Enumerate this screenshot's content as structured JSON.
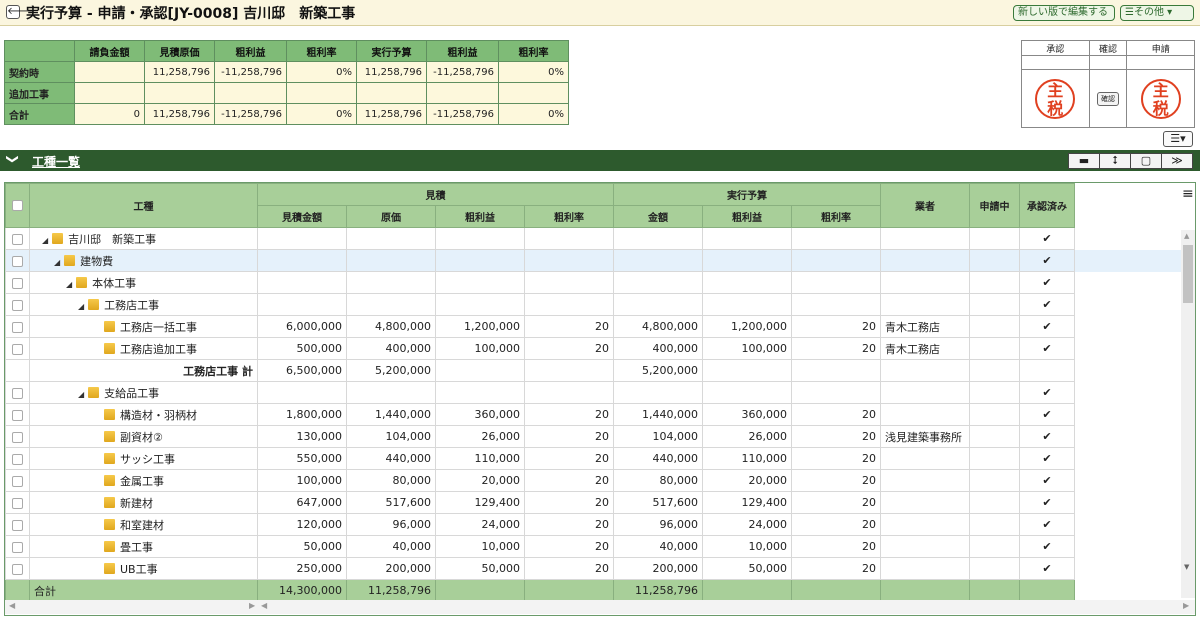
{
  "title": "実行予算 - 申請・承認[JY-0008] 吉川邸　新築工事",
  "toolbar": {
    "back_icon": "🡐",
    "new_version_label": "新しい版で編集する",
    "other_label": "☰その他 ▾"
  },
  "summary": {
    "headers": [
      "",
      "請負金額",
      "見積原価",
      "粗利益",
      "粗利率",
      "実行予算",
      "粗利益",
      "粗利率"
    ],
    "rows": [
      [
        "契約時",
        "",
        "11,258,796",
        "-11,258,796",
        "0%",
        "11,258,796",
        "-11,258,796",
        "0%"
      ],
      [
        "追加工事",
        "",
        "",
        "",
        "",
        "",
        "",
        ""
      ],
      [
        "合計",
        "0",
        "11,258,796",
        "-11,258,796",
        "0%",
        "11,258,796",
        "-11,258,796",
        "0%"
      ]
    ]
  },
  "approval": {
    "headers": [
      "承認",
      "確認",
      "申請"
    ],
    "stamp_text": "主\n税",
    "confirm_label": "確認",
    "menu_icon": "☰▾",
    "stamp_color": "#e04020"
  },
  "section": {
    "title": "工種一覧",
    "collapse_icon": "❯",
    "buttons": [
      "▬",
      "⭥",
      "▢",
      "≫"
    ]
  },
  "grid": {
    "group_headers": {
      "kind": "工種",
      "estimate": "見積",
      "budget": "実行予算",
      "vendor": "業者",
      "pending": "申請中",
      "approved": "承認済み"
    },
    "sub_headers": [
      "見積金額",
      "原価",
      "粗利益",
      "粗利率",
      "金額",
      "粗利益",
      "粗利率"
    ],
    "check_mark": "✔",
    "rows": [
      {
        "level": 0,
        "tri": true,
        "folder": true,
        "name": "吉川邸　新築工事",
        "vals": [
          "",
          "",
          "",
          "",
          "",
          "",
          ""
        ],
        "vendor": "",
        "approved": true
      },
      {
        "level": 1,
        "tri": true,
        "folder": true,
        "name": "建物費",
        "vals": [
          "",
          "",
          "",
          "",
          "",
          "",
          ""
        ],
        "vendor": "",
        "approved": true,
        "hl": true
      },
      {
        "level": 2,
        "tri": true,
        "folder": true,
        "name": "本体工事",
        "vals": [
          "",
          "",
          "",
          "",
          "",
          "",
          ""
        ],
        "vendor": "",
        "approved": true
      },
      {
        "level": 3,
        "tri": true,
        "folder": true,
        "name": "工務店工事",
        "vals": [
          "",
          "",
          "",
          "",
          "",
          "",
          ""
        ],
        "vendor": "",
        "approved": true
      },
      {
        "level": 4,
        "tri": false,
        "folder": true,
        "name": "工務店一括工事",
        "vals": [
          "6,000,000",
          "4,800,000",
          "1,200,000",
          "20",
          "4,800,000",
          "1,200,000",
          "20"
        ],
        "vendor": "青木工務店",
        "approved": true
      },
      {
        "level": 4,
        "tri": false,
        "folder": true,
        "name": "工務店追加工事",
        "vals": [
          "500,000",
          "400,000",
          "100,000",
          "20",
          "400,000",
          "100,000",
          "20"
        ],
        "vendor": "青木工務店",
        "approved": true
      },
      {
        "subtotal": true,
        "name": "工務店工事 計",
        "vals": [
          "6,500,000",
          "5,200,000",
          "",
          "",
          "5,200,000",
          "",
          ""
        ],
        "vendor": "",
        "approved": false
      },
      {
        "level": 3,
        "tri": true,
        "folder": true,
        "name": "支給品工事",
        "vals": [
          "",
          "",
          "",
          "",
          "",
          "",
          ""
        ],
        "vendor": "",
        "approved": true
      },
      {
        "level": 4,
        "tri": false,
        "folder": true,
        "name": "構造材・羽柄材",
        "vals": [
          "1,800,000",
          "1,440,000",
          "360,000",
          "20",
          "1,440,000",
          "360,000",
          "20"
        ],
        "vendor": "",
        "approved": true
      },
      {
        "level": 4,
        "tri": false,
        "folder": true,
        "name": "副資材②",
        "vals": [
          "130,000",
          "104,000",
          "26,000",
          "20",
          "104,000",
          "26,000",
          "20"
        ],
        "vendor": "浅見建築事務所",
        "approved": true
      },
      {
        "level": 4,
        "tri": false,
        "folder": true,
        "name": "サッシ工事",
        "vals": [
          "550,000",
          "440,000",
          "110,000",
          "20",
          "440,000",
          "110,000",
          "20"
        ],
        "vendor": "",
        "approved": true
      },
      {
        "level": 4,
        "tri": false,
        "folder": true,
        "name": "金属工事",
        "vals": [
          "100,000",
          "80,000",
          "20,000",
          "20",
          "80,000",
          "20,000",
          "20"
        ],
        "vendor": "",
        "approved": true
      },
      {
        "level": 4,
        "tri": false,
        "folder": true,
        "name": "新建材",
        "vals": [
          "647,000",
          "517,600",
          "129,400",
          "20",
          "517,600",
          "129,400",
          "20"
        ],
        "vendor": "",
        "approved": true
      },
      {
        "level": 4,
        "tri": false,
        "folder": true,
        "name": "和室建材",
        "vals": [
          "120,000",
          "96,000",
          "24,000",
          "20",
          "96,000",
          "24,000",
          "20"
        ],
        "vendor": "",
        "approved": true
      },
      {
        "level": 4,
        "tri": false,
        "folder": true,
        "name": "畳工事",
        "vals": [
          "50,000",
          "40,000",
          "10,000",
          "20",
          "40,000",
          "10,000",
          "20"
        ],
        "vendor": "",
        "approved": true
      },
      {
        "level": 4,
        "tri": false,
        "folder": true,
        "name": "UB工事",
        "vals": [
          "250,000",
          "200,000",
          "50,000",
          "20",
          "200,000",
          "50,000",
          "20"
        ],
        "vendor": "",
        "approved": true
      }
    ],
    "total": {
      "label": "合計",
      "vals": [
        "14,300,000",
        "11,258,796",
        "",
        "",
        "11,258,796",
        "",
        ""
      ]
    },
    "menu_icon": "≡"
  },
  "scrollbar": {
    "up": "▲",
    "down": "▼",
    "left": "◀",
    "right": "▶"
  }
}
